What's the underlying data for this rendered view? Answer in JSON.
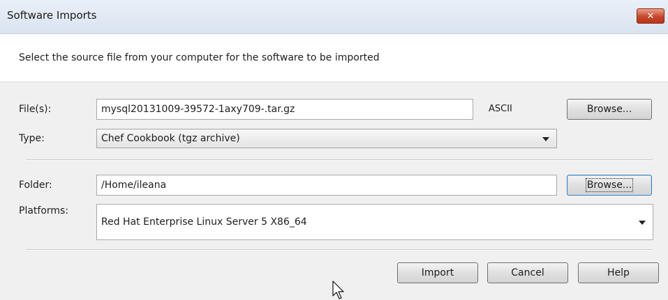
{
  "window": {
    "title": "Software Imports",
    "close_glyph": "✕"
  },
  "instruction": "Select the source file from your computer for the software to be imported",
  "form": {
    "files_label": "File(s):",
    "files_value": "mysql20131009-39572-1axy709-.tar.gz",
    "encoding": "ASCII",
    "browse_files_label": "Browse...",
    "type_label": "Type:",
    "type_value": "Chef Cookbook  (tgz archive)",
    "folder_label": "Folder:",
    "folder_value": "/Home/ileana",
    "browse_folder_label": "Browse...",
    "platforms_label": "Platforms:",
    "platforms_value": "Red Hat Enterprise Linux Server 5 X86_64"
  },
  "footer": {
    "import_label": "Import",
    "cancel_label": "Cancel",
    "help_label": "Help"
  },
  "icons": {
    "close": "close-icon",
    "dropdown": "chevron-down-icon",
    "cursor": "mouse-pointer-icon"
  }
}
